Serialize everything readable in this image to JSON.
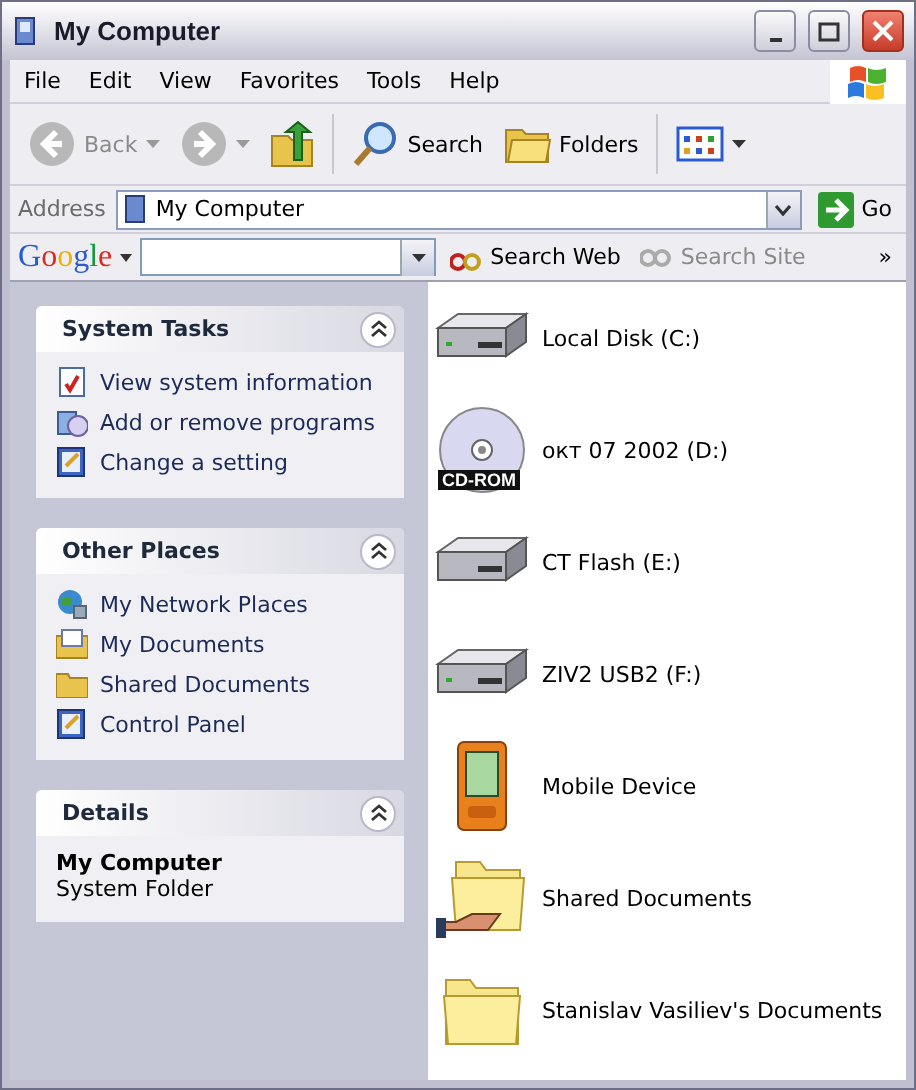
{
  "window": {
    "title": "My Computer"
  },
  "menu": [
    "File",
    "Edit",
    "View",
    "Favorites",
    "Tools",
    "Help"
  ],
  "toolbar": {
    "back": {
      "label": "Back",
      "disabled": true
    },
    "forward": {
      "disabled": true
    },
    "search": "Search",
    "folders": "Folders"
  },
  "address": {
    "label": "Address",
    "value": "My Computer",
    "go": "Go"
  },
  "google_bar": {
    "logo": "Google",
    "search_web": {
      "label": "Search Web",
      "disabled": false
    },
    "search_site": {
      "label": "Search Site",
      "disabled": true
    },
    "more": "»"
  },
  "task_panes": [
    {
      "title": "System Tasks",
      "expanded": true,
      "links": [
        {
          "label": "View system information",
          "kind": "sysinfo"
        },
        {
          "label": "Add or remove programs",
          "kind": "programs"
        },
        {
          "label": "Change a setting",
          "kind": "control"
        }
      ]
    },
    {
      "title": "Other Places",
      "expanded": true,
      "links": [
        {
          "label": "My Network Places",
          "kind": "network"
        },
        {
          "label": "My Documents",
          "kind": "documents"
        },
        {
          "label": "Shared Documents",
          "kind": "folder"
        },
        {
          "label": "Control Panel",
          "kind": "control"
        }
      ]
    },
    {
      "title": "Details",
      "expanded": true,
      "details": {
        "name": "My Computer",
        "type": "System Folder"
      }
    }
  ],
  "items": [
    {
      "label": "Local Disk (C:)",
      "kind": "hdd"
    },
    {
      "label": "окт 07 2002 (D:)",
      "kind": "cdrom",
      "badge": "CD-ROM"
    },
    {
      "label": "CT Flash (E:)",
      "kind": "removable"
    },
    {
      "label": "ZIV2 USB2 (F:)",
      "kind": "hdd"
    },
    {
      "label": "Mobile Device",
      "kind": "mobile"
    },
    {
      "label": "Shared Documents",
      "kind": "shared"
    },
    {
      "label": "Stanislav Vasiliev's Documents",
      "kind": "folder"
    }
  ]
}
